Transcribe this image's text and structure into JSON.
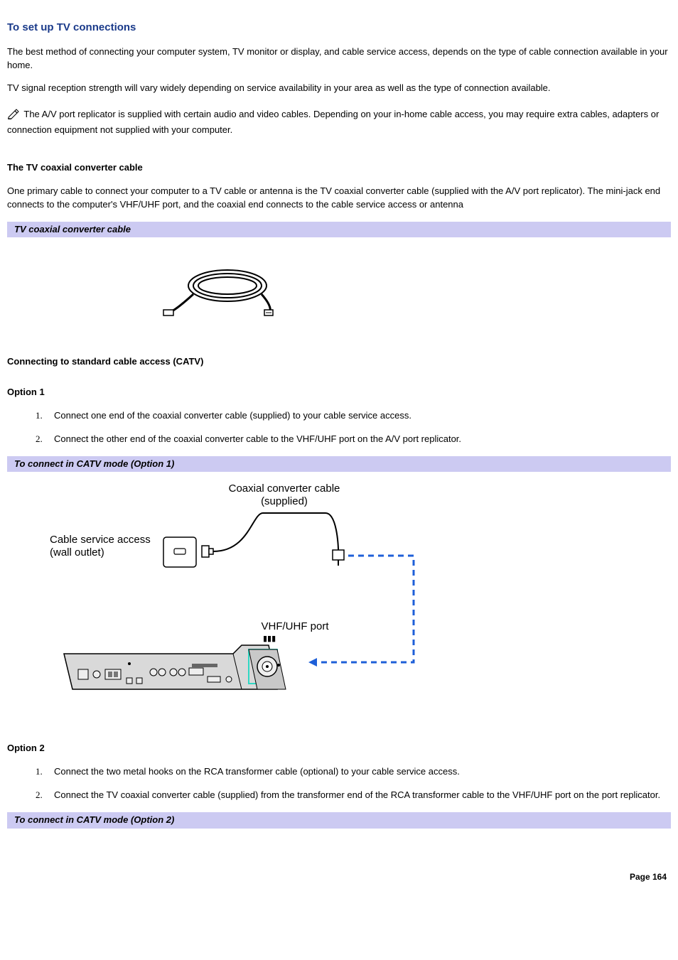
{
  "page_title": "To set up TV connections",
  "intro_p1": "The best method of connecting your computer system, TV monitor or display, and cable service access, depends on the type of cable connection available in your home.",
  "intro_p2": "TV signal reception strength will vary widely depending on service availability in your area as well as the type of connection available.",
  "note_text": "The A/V port replicator is supplied with certain audio and video cables. Depending on your in-home cable access, you may require extra cables, adapters or connection equipment not supplied with your computer.",
  "section_coax_heading": "The TV coaxial converter cable",
  "section_coax_p": "One primary cable to connect your computer to a TV cable or antenna is the TV coaxial converter cable (supplied with the A/V port replicator). The mini-jack end connects to the computer's VHF/UHF port, and the coaxial end connects to the cable service access or antenna",
  "bar_cable": "TV coaxial converter cable",
  "section_catv_heading": "Connecting to standard cable access (CATV)",
  "option1_heading": "Option 1",
  "option1_steps": [
    "Connect one end of the coaxial converter cable (supplied) to your cable service access.",
    "Connect the other end of the coaxial converter cable to the VHF/UHF port on the A/V port replicator."
  ],
  "bar_option1": "To connect in CATV mode (Option 1)",
  "diagram_labels": {
    "coax_label_l1": "Coaxial converter cable",
    "coax_label_l2": "(supplied)",
    "wall_l1": "Cable service access",
    "wall_l2": "(wall outlet)",
    "port_label": "VHF/UHF port"
  },
  "option2_heading": "Option 2",
  "option2_steps": [
    "Connect the two metal hooks on the RCA transformer cable (optional) to your cable service access.",
    "Connect the TV coaxial converter cable (supplied) from the transformer end of the RCA transformer cable to the VHF/UHF port on the port replicator."
  ],
  "bar_option2": "To connect in CATV mode (Option 2)",
  "page_number": "Page 164"
}
